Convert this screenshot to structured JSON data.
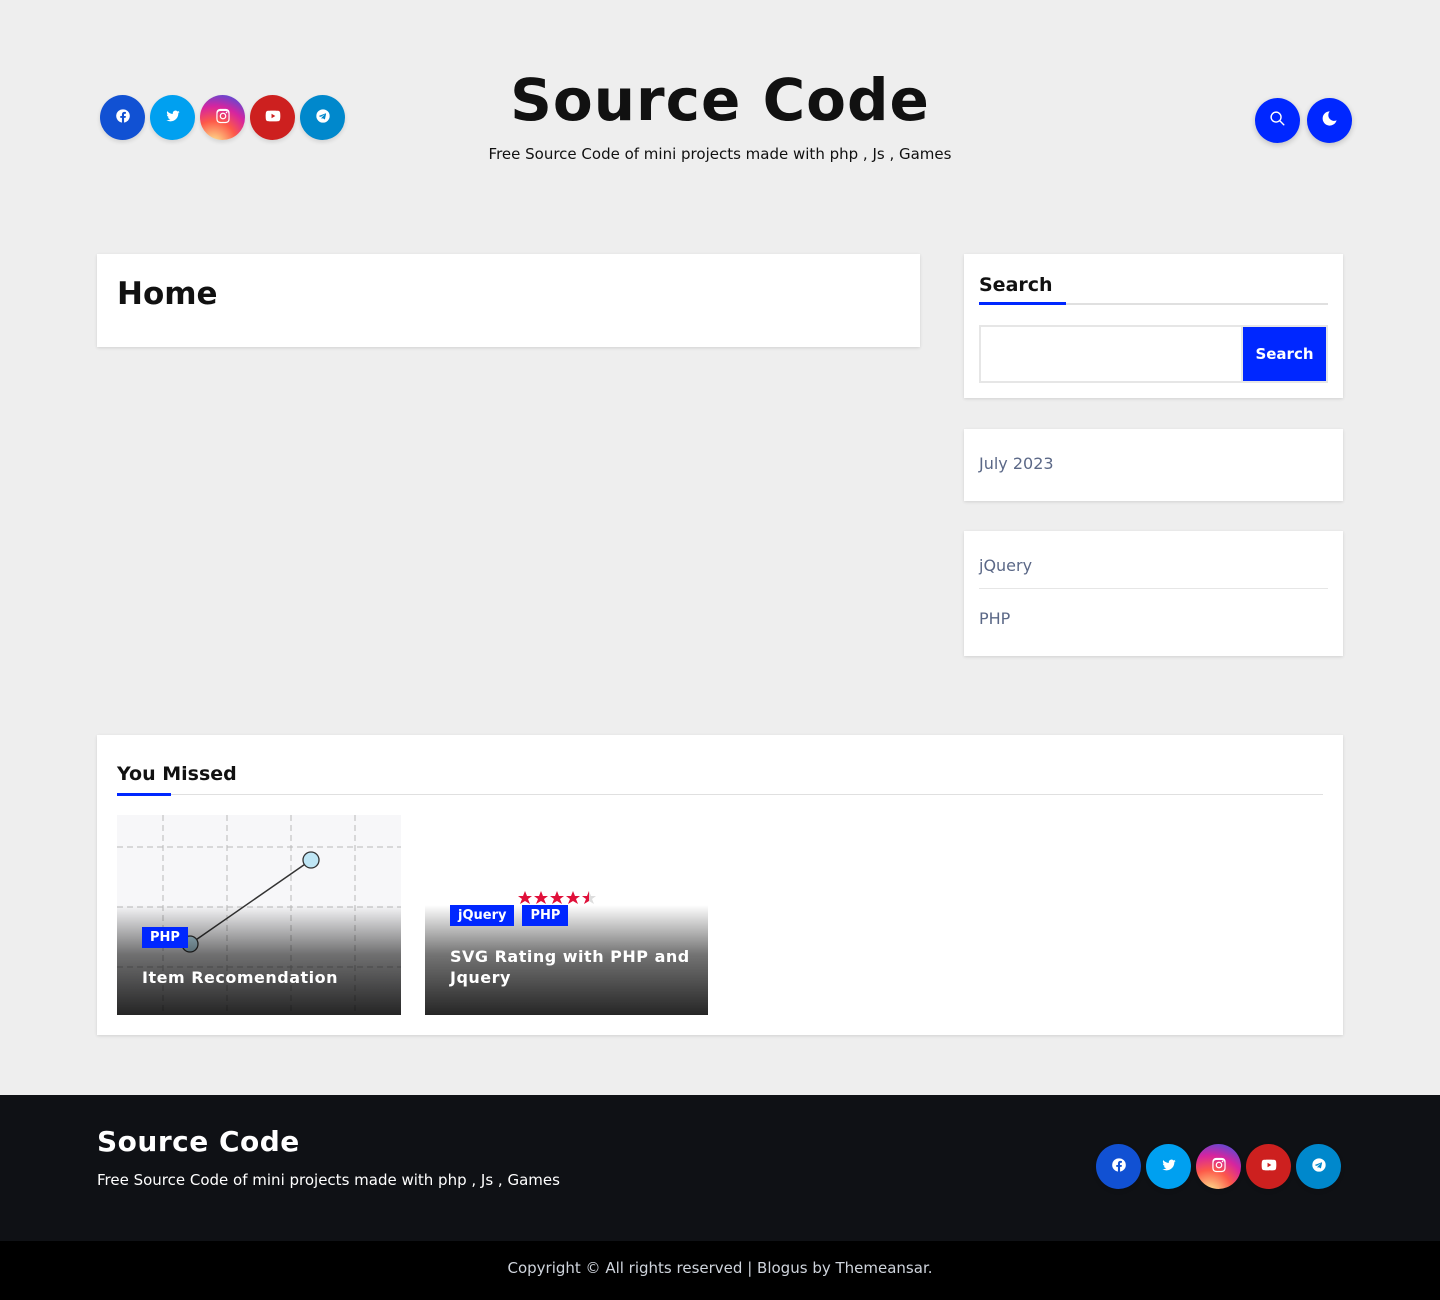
{
  "header": {
    "site_title": "Source Code",
    "site_description": "Free Source Code of mini projects made with php , Js , Games",
    "social_icons": [
      "facebook-icon",
      "twitter-icon",
      "instagram-icon",
      "youtube-icon",
      "telegram-icon"
    ],
    "buttons": [
      "search-icon",
      "moon-icon"
    ]
  },
  "main": {
    "page_title": "Home"
  },
  "sidebar": {
    "search": {
      "title": "Search",
      "input_value": "",
      "button_label": "Search"
    },
    "archives": [
      "July 2023"
    ],
    "categories": [
      "jQuery",
      "PHP"
    ]
  },
  "you_missed": {
    "title": "You Missed",
    "posts": [
      {
        "categories": [
          "PHP"
        ],
        "title": "Item Recomendation"
      },
      {
        "categories": [
          "jQuery",
          "PHP"
        ],
        "title": "SVG Rating with PHP and Jquery"
      }
    ]
  },
  "footer": {
    "site_title": "Source Code",
    "site_description": "Free Source Code of mini projects made with php , Js , Games",
    "copyright_text": "Copyright © All rights reserved",
    "separator": "|",
    "theme_name": "Blogus",
    "by_text": "by",
    "author": "Themeansar."
  },
  "colors": {
    "accent": "#0027ff",
    "background": "#eeeeee",
    "footer_top": "#0f1115",
    "footer_bottom": "#000000"
  }
}
